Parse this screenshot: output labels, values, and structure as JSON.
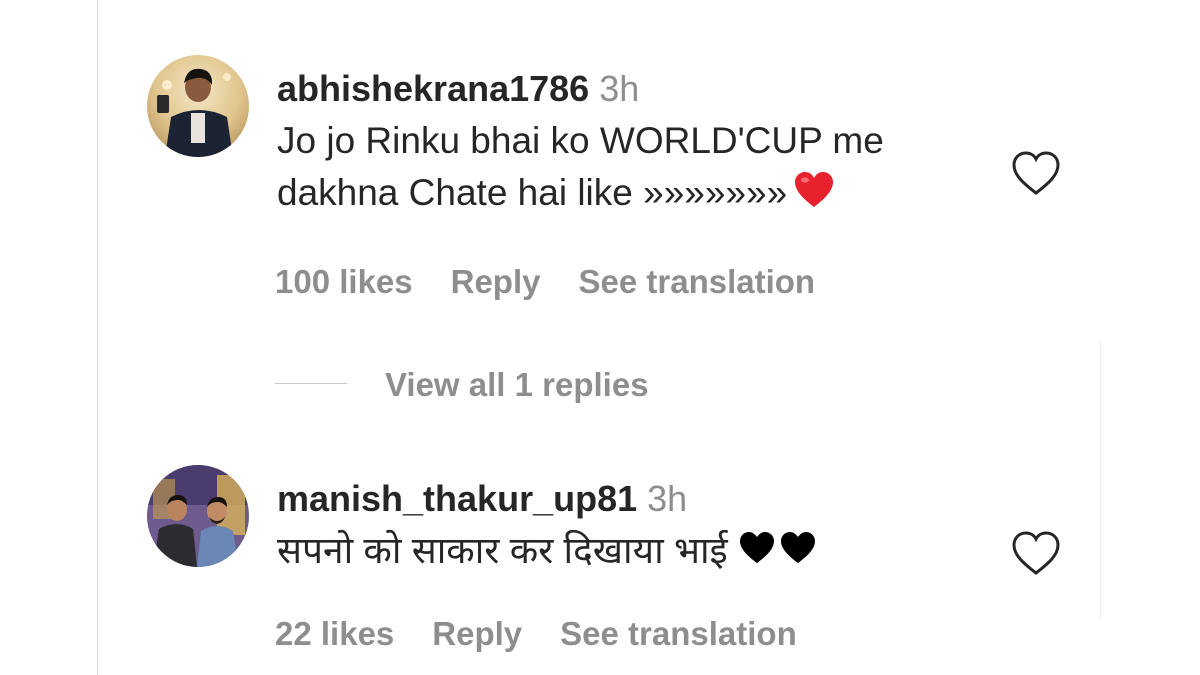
{
  "comments": [
    {
      "username": "abhishekrana1786",
      "time": "3h",
      "text_line1": "Jo jo Rinku bhai ko WORLD'CUP me",
      "text_line2": "dakhna Chate hai like »»»»»»»",
      "emoji": "red-heart",
      "likes": "100 likes",
      "reply": "Reply",
      "translate": "See translation"
    },
    {
      "username": "manish_thakur_up81",
      "time": "3h",
      "text_line1": "सपनो को साकार कर दिखाया भाई",
      "emoji": "black-hearts",
      "likes": "22 likes",
      "reply": "Reply",
      "translate": "See translation"
    }
  ],
  "view_replies": "View all 1 replies",
  "colors": {
    "text": "#262626",
    "secondary": "#8e8e8e",
    "heart_red": "#e8212e",
    "divider": "#dbdbdb"
  }
}
